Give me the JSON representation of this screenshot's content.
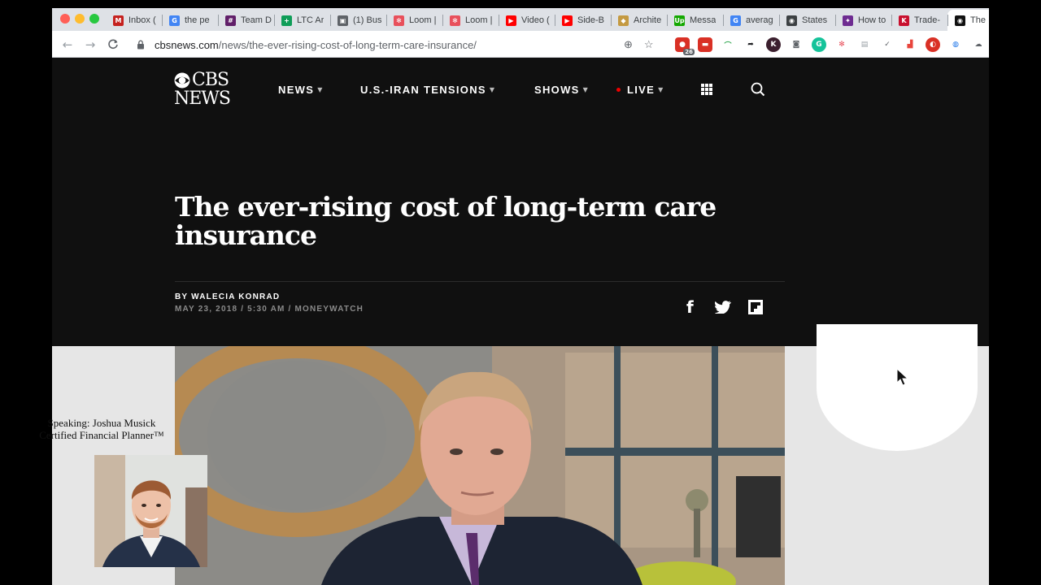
{
  "browser": {
    "tabs": [
      {
        "label": "Inbox (",
        "icon": "gmail-icon",
        "color": "#c5221f",
        "glyph": "M"
      },
      {
        "label": "the pe",
        "icon": "google-icon",
        "color": "#4285f4",
        "glyph": "G"
      },
      {
        "label": "Team D",
        "icon": "slack-icon",
        "color": "#611f69",
        "glyph": "#"
      },
      {
        "label": "LTC Ar",
        "icon": "sheets-icon",
        "color": "#0f9d58",
        "glyph": "+"
      },
      {
        "label": "(1) Bus",
        "icon": "page-icon",
        "color": "#5f6368",
        "glyph": "▣"
      },
      {
        "label": "Loom |",
        "icon": "loom-icon",
        "color": "#e8505b",
        "glyph": "✻"
      },
      {
        "label": "Loom |",
        "icon": "loom-icon",
        "color": "#e8505b",
        "glyph": "✻"
      },
      {
        "label": "Video (",
        "icon": "youtube-icon",
        "color": "#ff0000",
        "glyph": "▶"
      },
      {
        "label": "Side-B",
        "icon": "youtube-icon",
        "color": "#ff0000",
        "glyph": "▶"
      },
      {
        "label": "Archite",
        "icon": "shield-icon",
        "color": "#c49a42",
        "glyph": "◆"
      },
      {
        "label": "Messa",
        "icon": "upwork-icon",
        "color": "#14a800",
        "glyph": "Up"
      },
      {
        "label": "averag",
        "icon": "google-icon",
        "color": "#4285f4",
        "glyph": "G"
      },
      {
        "label": "States",
        "icon": "globe-icon",
        "color": "#3c4043",
        "glyph": "◉"
      },
      {
        "label": "How to",
        "icon": "nbc-icon",
        "color": "#6e2c91",
        "glyph": "✦"
      },
      {
        "label": "Trade-",
        "icon": "k-icon",
        "color": "#c8102e",
        "glyph": "K"
      },
      {
        "label": "The",
        "icon": "cbs-eye-icon",
        "color": "#111111",
        "glyph": "◉"
      }
    ],
    "url_domain": "cbsnews.com",
    "url_path": "/news/the-ever-rising-cost-of-long-term-care-insurance/",
    "ext_badge": "26"
  },
  "site": {
    "logo_line1": "CBS",
    "logo_line2": "NEWS",
    "nav": {
      "news": "NEWS",
      "iran": "U.S.-IRAN TENSIONS",
      "shows": "SHOWS",
      "live": "LIVE"
    }
  },
  "article": {
    "headline": "The ever-rising cost of long-term care insurance",
    "byline_prefix": "BY",
    "byline_name": "WALECIA KONRAD",
    "dateline": "MAY 23, 2018 / 5:30 AM / MONEYWATCH"
  },
  "overlay": {
    "caption_line1": "Speaking: Joshua Musick",
    "caption_line2": "Certified Financial Planner™"
  },
  "colors": {
    "page_bg": "#101010",
    "live_dot": "#ee0000",
    "media_band": "#e6e6e6"
  }
}
